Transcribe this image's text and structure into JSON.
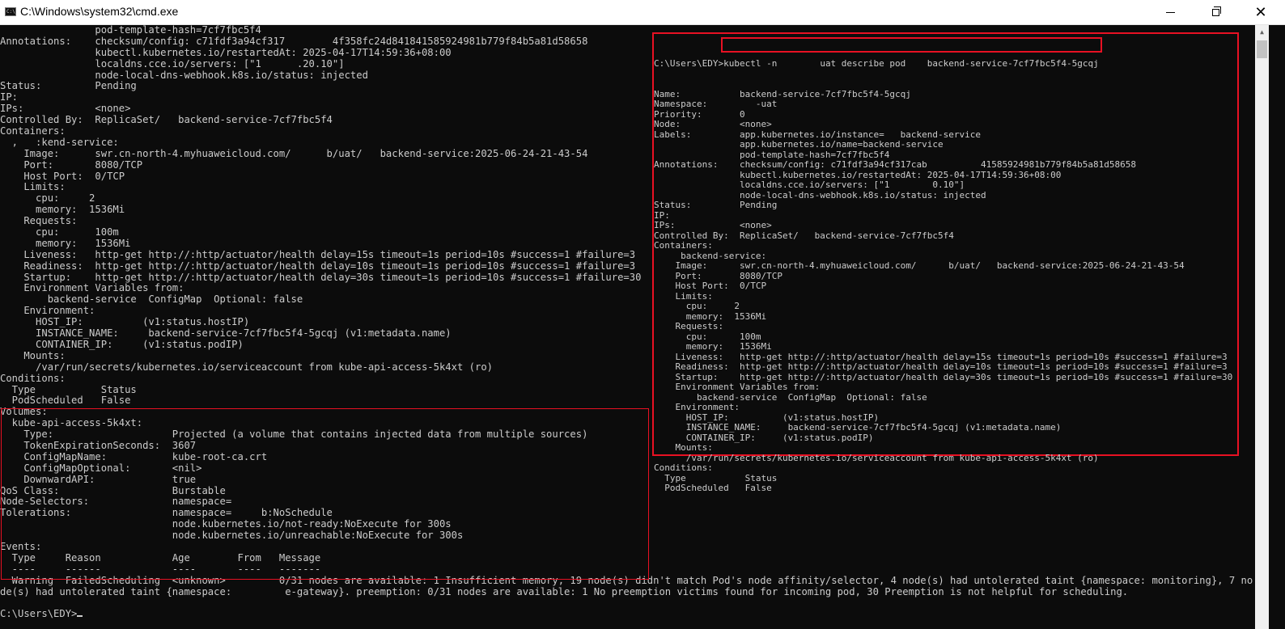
{
  "window": {
    "title": "C:\\Windows\\system32\\cmd.exe",
    "icon": "cmd-app-icon",
    "minimize_icon": "minimize-icon",
    "maximize_icon": "restore-icon",
    "close_icon": "close-icon"
  },
  "colors": {
    "background": "#0c0c0c",
    "text": "#cccccc",
    "highlight": "#e81123"
  },
  "terminal_lines": [
    "                pod-template-hash=7cf7fbc5f4",
    "Annotations:    checksum/config: c71fdf3a94cf317        4f358fc24d841841585924981b779f84b5a81d58658",
    "                kubectl.kubernetes.io/restartedAt: 2025-04-17T14:59:36+08:00",
    "                localdns.cce.io/servers: [\"1      .20.10\"]",
    "                node-local-dns-webhook.k8s.io/status: injected",
    "Status:         Pending",
    "IP:",
    "IPs:            <none>",
    "Controlled By:  ReplicaSet/   backend-service-7cf7fbc5f4",
    "Containers:",
    "  ,   :kend-service:",
    "    Image:      swr.cn-north-4.myhuaweicloud.com/      b/uat/   backend-service:2025-06-24-21-43-54",
    "    Port:       8080/TCP",
    "    Host Port:  0/TCP",
    "    Limits:",
    "      cpu:     2",
    "      memory:  1536Mi",
    "    Requests:",
    "      cpu:      100m",
    "      memory:   1536Mi",
    "    Liveness:   http-get http://:http/actuator/health delay=15s timeout=1s period=10s #success=1 #failure=3",
    "    Readiness:  http-get http://:http/actuator/health delay=10s timeout=1s period=10s #success=1 #failure=3",
    "    Startup:    http-get http://:http/actuator/health delay=30s timeout=1s period=10s #success=1 #failure=30",
    "    Environment Variables from:",
    "        backend-service  ConfigMap  Optional: false",
    "    Environment:",
    "      HOST_IP:          (v1:status.hostIP)",
    "      INSTANCE_NAME:     backend-service-7cf7fbc5f4-5gcqj (v1:metadata.name)",
    "      CONTAINER_IP:     (v1:status.podIP)",
    "    Mounts:",
    "      /var/run/secrets/kubernetes.io/serviceaccount from kube-api-access-5k4xt (ro)",
    "Conditions:",
    "  Type           Status",
    "  PodScheduled   False",
    "Volumes:",
    "  kube-api-access-5k4xt:",
    "    Type:                    Projected (a volume that contains injected data from multiple sources)",
    "    TokenExpirationSeconds:  3607",
    "    ConfigMapName:           kube-root-ca.crt",
    "    ConfigMapOptional:       <nil>",
    "    DownwardAPI:             true",
    "QoS Class:                   Burstable",
    "Node-Selectors:              namespace=",
    "Tolerations:                 namespace=     b:NoSchedule",
    "                             node.kubernetes.io/not-ready:NoExecute for 300s",
    "                             node.kubernetes.io/unreachable:NoExecute for 300s",
    "Events:",
    "  Type     Reason            Age        From   Message",
    "  ----     ------            ----       ----   -------",
    "  Warning  FailedScheduling  <unknown>         0/31 nodes are available: 1 Insufficient memory, 19 node(s) didn't match Pod's node affinity/selector, 4 node(s) had untolerated taint {namespace: monitoring}, 7 no",
    "de(s) had untolerated taint {namespace:         e-gateway}. preemption: 0/31 nodes are available: 1 No preemption victims found for incoming pod, 30 Preemption is not helpful for scheduling.",
    ""
  ],
  "prompt": "C:\\Users\\EDY>",
  "inset": {
    "prompt": "C:\\Users\\EDY",
    "command": "kubectl -n        uat describe pod    backend-service-7cf7fbc5f4-5gcqj",
    "lines": [
      "Name:           backend-service-7cf7fbc5f4-5gcqj",
      "Namespace:         -uat",
      "Priority:       0",
      "Node:           <none>",
      "Labels:         app.kubernetes.io/instance=   backend-service",
      "                app.kubernetes.io/name=backend-service",
      "                pod-template-hash=7cf7fbc5f4",
      "Annotations:    checksum/config: c71fdf3a94cf317cab          41585924981b779f84b5a81d58658",
      "                kubectl.kubernetes.io/restartedAt: 2025-04-17T14:59:36+08:00",
      "                localdns.cce.io/servers: [\"1        0.10\"]",
      "                node-local-dns-webhook.k8s.io/status: injected",
      "Status:         Pending",
      "IP:",
      "IPs:            <none>",
      "Controlled By:  ReplicaSet/   backend-service-7cf7fbc5f4",
      "Containers:",
      "     backend-service:",
      "    Image:      swr.cn-north-4.myhuaweicloud.com/      b/uat/   backend-service:2025-06-24-21-43-54",
      "    Port:       8080/TCP",
      "    Host Port:  0/TCP",
      "    Limits:",
      "      cpu:     2",
      "      memory:  1536Mi",
      "    Requests:",
      "      cpu:      100m",
      "      memory:   1536Mi",
      "    Liveness:   http-get http://:http/actuator/health delay=15s timeout=1s period=10s #success=1 #failure=3",
      "    Readiness:  http-get http://:http/actuator/health delay=10s timeout=1s period=10s #success=1 #failure=3",
      "    Startup:    http-get http://:http/actuator/health delay=30s timeout=1s period=10s #success=1 #failure=30",
      "    Environment Variables from:",
      "        backend-service  ConfigMap  Optional: false",
      "    Environment:",
      "      HOST_IP:          (v1:status.hostIP)",
      "      INSTANCE_NAME:     backend-service-7cf7fbc5f4-5gcqj (v1:metadata.name)",
      "      CONTAINER_IP:     (v1:status.podIP)",
      "    Mounts:",
      "      /var/run/secrets/kubernetes.io/serviceaccount from kube-api-access-5k4xt (ro)",
      "Conditions:",
      "  Type           Status",
      "  PodScheduled   False"
    ]
  }
}
